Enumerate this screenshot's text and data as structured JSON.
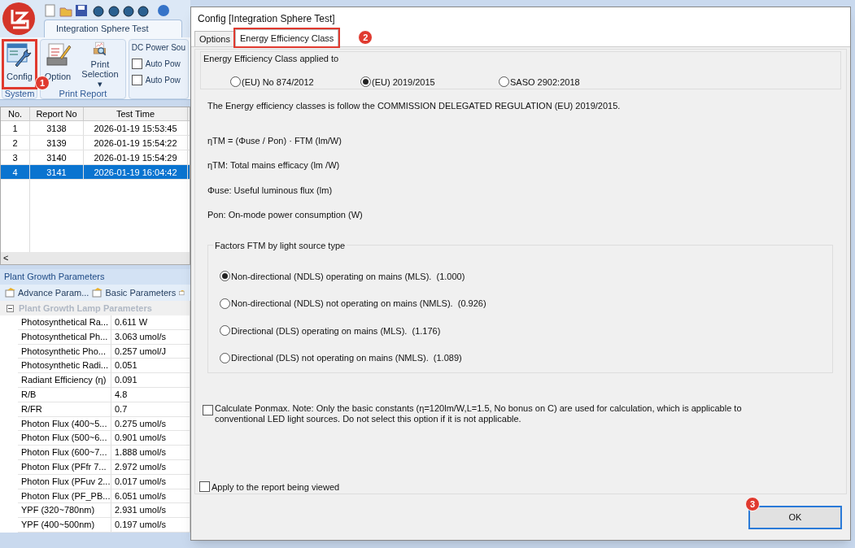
{
  "ribbon": {
    "tab": "Integration Sphere Test",
    "groups": [
      {
        "label": "System",
        "buttons": [
          {
            "label": "Config",
            "kind": "config",
            "highlighted": true,
            "badge": "1"
          }
        ]
      },
      {
        "label": "Print Report",
        "buttons": [
          {
            "label": "Option",
            "kind": "option",
            "highlighted": false
          },
          {
            "label": "Print Selection",
            "kind": "print",
            "highlighted": false,
            "dropdown_mark": "▾"
          }
        ]
      }
    ],
    "power": {
      "title": "DC Power Sou",
      "checkboxes": [
        {
          "label": "Auto Pow",
          "checked": false
        },
        {
          "label": "Auto Pow",
          "checked": false
        }
      ]
    }
  },
  "report_table": {
    "columns": [
      "No.",
      "Report No",
      "Test Time"
    ],
    "rows": [
      {
        "cells": [
          "1",
          "3138",
          "2026-01-19 15:53:45"
        ],
        "selected": false
      },
      {
        "cells": [
          "2",
          "3139",
          "2026-01-19 15:54:22"
        ],
        "selected": false
      },
      {
        "cells": [
          "3",
          "3140",
          "2026-01-19 15:54:29"
        ],
        "selected": false
      },
      {
        "cells": [
          "4",
          "3141",
          "2026-01-19 16:04:42"
        ],
        "selected": true
      }
    ],
    "scroll_left": "<"
  },
  "parameters": {
    "title": "Plant Growth Parameters",
    "tabs": [
      {
        "label": "Advance Param...",
        "selected": false
      },
      {
        "label": "Basic Parameters",
        "selected": false
      }
    ],
    "category": {
      "label": "Plant Growth Lamp Parameters",
      "expanded": true
    },
    "rows": [
      [
        "Photosynthetical Ra...",
        "0.611 W"
      ],
      [
        "Photosynthetical Ph...",
        "3.063 umol/s"
      ],
      [
        "Photosynthetic Pho...",
        "0.257 umol/J"
      ],
      [
        "Photosynthetic Radi...",
        "0.051"
      ],
      [
        "Radiant Efficiency (η)",
        "0.091"
      ],
      [
        "R/B",
        "4.8"
      ],
      [
        "R/FR",
        "0.7"
      ],
      [
        "Photon Flux (400~5...",
        "0.275 umol/s"
      ],
      [
        "Photon Flux (500~6...",
        "0.901 umol/s"
      ],
      [
        "Photon Flux (600~7...",
        "1.888 umol/s"
      ],
      [
        "Photon Flux (PFfr 7...",
        "2.972 umol/s"
      ],
      [
        "Photon Flux (PFuv 2...",
        "0.017 umol/s"
      ],
      [
        "Photon Flux (PF_PB...",
        "6.051 umol/s"
      ],
      [
        "YPF (320~780nm)",
        "2.931 umol/s"
      ],
      [
        "YPF (400~500nm)",
        "0.197 umol/s"
      ]
    ]
  },
  "dialog": {
    "title": "Config [Integration Sphere Test]",
    "tabs": [
      {
        "label": "Options",
        "selected": false,
        "highlighted": false
      },
      {
        "label": "Energy Efficiency Class",
        "selected": true,
        "highlighted": true,
        "badge": "2"
      }
    ],
    "applied_to": {
      "label": "Energy Efficiency Class applied to",
      "options": [
        {
          "label": "(EU) No 874/2012",
          "selected": false
        },
        {
          "label": "(EU) 2019/2015",
          "selected": true
        },
        {
          "label": "SASO 2902:2018",
          "selected": false
        }
      ]
    },
    "intro": "The Energy efficiency classes is follow the COMMISSION DELEGATED REGULATION (EU) 2019/2015.",
    "definitions": [
      "ηTM = (Φuse / Pon) · FTM (lm/W)",
      "ηTM: Total mains efficacy (lm /W)",
      "Φuse: Useful luminous flux (lm)",
      "Pon: On-mode power consumption (W)"
    ],
    "factors": {
      "title": "Factors FTM by light source type",
      "options": [
        {
          "label": "Non-directional (NDLS) operating on mains (MLS).  (1.000)",
          "selected": true
        },
        {
          "label": "Non-directional (NDLS) not operating on mains (NMLS).  (0.926)",
          "selected": false
        },
        {
          "label": "Directional (DLS) operating on mains (MLS).  (1.176)",
          "selected": false
        },
        {
          "label": "Directional (DLS) not operating on mains (NMLS).  (1.089)",
          "selected": false
        }
      ]
    },
    "ponmax": {
      "label": "Calculate Ponmax. Note: Only the basic constants (η=120lm/W,L=1.5, No bonus on C) are used for calculation, which is applicable to conventional LED light sources. Do not select this option if it is not applicable.",
      "checked": false
    },
    "apply_report": {
      "label": "Apply to the report being viewed",
      "checked": false
    },
    "ok_button": {
      "label": "OK",
      "badge": "3"
    }
  }
}
